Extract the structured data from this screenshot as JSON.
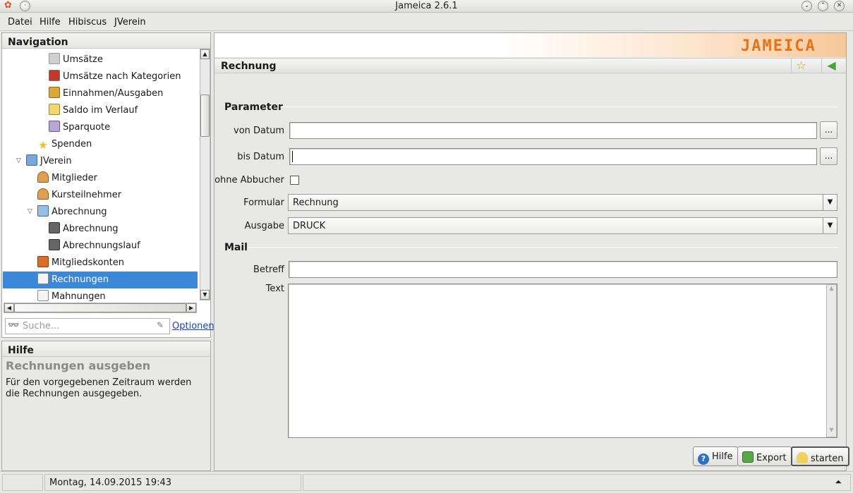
{
  "window": {
    "title": "Jameica 2.6.1"
  },
  "menu": [
    {
      "label": "Datei"
    },
    {
      "label": "Hilfe"
    },
    {
      "label": "Hibiscus"
    },
    {
      "label": "JVerein"
    }
  ],
  "navigation": {
    "header": "Navigation",
    "items": [
      {
        "label": "Umsätze",
        "icon": "transactions-icon",
        "color": "#c9c9c9"
      },
      {
        "label": "Umsätze nach Kategorien",
        "icon": "category-report-icon",
        "color": "#c0392b"
      },
      {
        "label": "Einnahmen/Ausgaben",
        "icon": "income-expense-icon",
        "color": "#d9a83a"
      },
      {
        "label": "Saldo im Verlauf",
        "icon": "balance-chart-icon",
        "color": "#e0c14a"
      },
      {
        "label": "Sparquote",
        "icon": "savings-chart-icon",
        "color": "#8a6fb0"
      },
      {
        "label": "Spenden",
        "icon": "star-icon",
        "color": "#f2c230"
      },
      {
        "label": "JVerein",
        "icon": "folder-icon",
        "color": "#5b8fd0",
        "expanded": true
      },
      {
        "label": "Mitglieder",
        "icon": "members-icon",
        "color": "#d88a3a"
      },
      {
        "label": "Kursteilnehmer",
        "icon": "course-participants-icon",
        "color": "#d88a3a"
      },
      {
        "label": "Abrechnung",
        "icon": "folder-open-icon",
        "color": "#5b8fd0",
        "expanded": true
      },
      {
        "label": "Abrechnung",
        "icon": "calculator-icon",
        "color": "#555555"
      },
      {
        "label": "Abrechnungslauf",
        "icon": "calculator-icon",
        "color": "#555555"
      },
      {
        "label": "Mitgliedskonten",
        "icon": "member-accounts-icon",
        "color": "#d9702a"
      },
      {
        "label": "Rechnungen",
        "icon": "invoice-icon",
        "color": "#e8e8e8",
        "selected": true
      },
      {
        "label": "Mahnungen",
        "icon": "reminder-icon",
        "color": "#e8e8e8"
      }
    ],
    "search_placeholder": "Suche...",
    "options_link": "Optionen"
  },
  "help_panel": {
    "header": "Hilfe",
    "title": "Rechnungen ausgeben",
    "text": "Für den vorgegebenen Zeitraum werden die Rechnungen ausgegeben."
  },
  "main": {
    "logo_text": "JAMEICA",
    "view_title": "Rechnung",
    "parameter": {
      "section": "Parameter",
      "von_datum_label": "von Datum",
      "von_datum_value": "",
      "bis_datum_label": "bis Datum",
      "bis_datum_value": "",
      "date_button": "...",
      "ohne_abbucher_label": "ohne Abbucher",
      "ohne_abbucher_checked": false,
      "formular_label": "Formular",
      "formular_value": "Rechnung",
      "ausgabe_label": "Ausgabe",
      "ausgabe_value": "DRUCK"
    },
    "mail": {
      "section": "Mail",
      "betreff_label": "Betreff",
      "betreff_value": "",
      "text_label": "Text",
      "text_value": ""
    },
    "buttons": {
      "hilfe": "Hilfe",
      "export": "Export",
      "starten": "starten"
    }
  },
  "statusbar": {
    "datetime": "Montag, 14.09.2015 19:43"
  },
  "colors": {
    "selection": "#3d87d8",
    "logo": "#e2731d",
    "link": "#1a3fb8"
  }
}
